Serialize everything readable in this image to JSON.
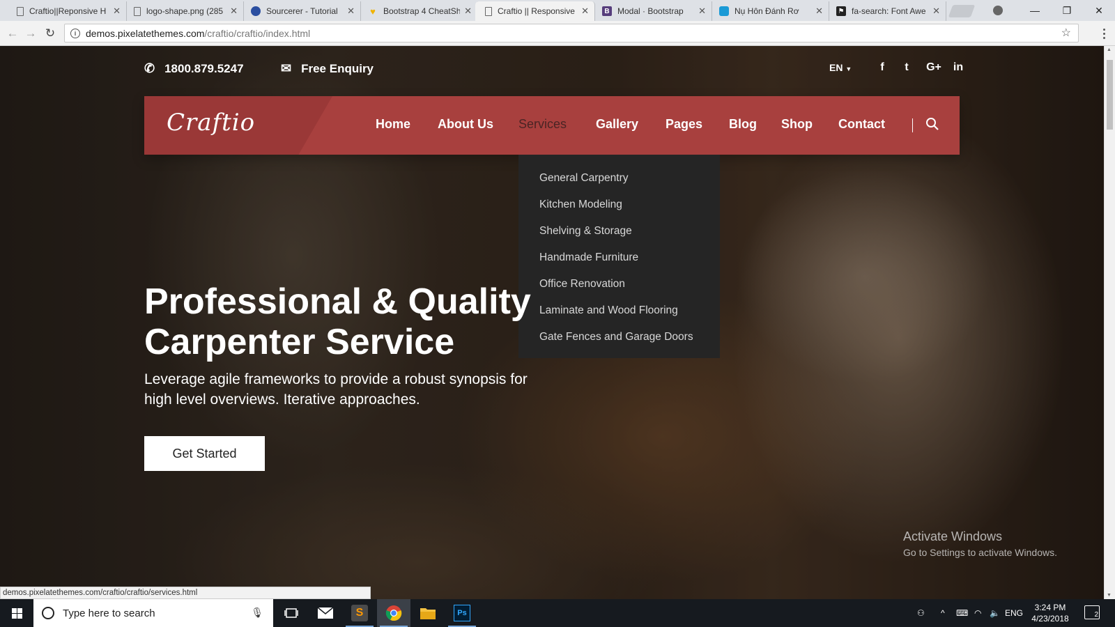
{
  "browser": {
    "tabs": [
      {
        "title": "Craftio||Reponsive H",
        "favicon": "page-icon"
      },
      {
        "title": "logo-shape.png (285",
        "favicon": "page-icon"
      },
      {
        "title": "Sourcerer - Tutorial",
        "favicon": "shield-icon"
      },
      {
        "title": "Bootstrap 4 CheatSh",
        "favicon": "heart-icon"
      },
      {
        "title": "Craftio || Responsive",
        "favicon": "page-icon",
        "active": true
      },
      {
        "title": "Modal · Bootstrap",
        "favicon": "bootstrap-icon"
      },
      {
        "title": "Nụ Hôn Đánh Rơ",
        "favicon": "zing-icon"
      },
      {
        "title": "fa-search: Font Awe",
        "favicon": "flag-icon"
      }
    ],
    "url_host": "demos.pixelatethemes.com",
    "url_path": "/craftio/craftio/index.html",
    "status_url": "demos.pixelatethemes.com/craftio/craftio/services.html"
  },
  "topbar": {
    "phone": "1800.879.5247",
    "enquiry": "Free Enquiry",
    "language": "EN",
    "social": [
      "f",
      "t",
      "G+",
      "in"
    ]
  },
  "nav": {
    "logo": "Craftio",
    "links": [
      "Home",
      "About Us",
      "Services",
      "Gallery",
      "Pages",
      "Blog",
      "Shop",
      "Contact"
    ],
    "current": "Services"
  },
  "dropdown": {
    "items": [
      "General Carpentry",
      "Kitchen Modeling",
      "Shelving & Storage",
      "Handmade Furniture",
      "Office Renovation",
      "Laminate and Wood Flooring",
      "Gate Fences and Garage Doors"
    ]
  },
  "hero": {
    "title_line1": "Professional & Quality",
    "title_line2": "Carpenter Service",
    "subtitle": "Leverage agile frameworks to provide a robust synopsis for high level overviews. Iterative approaches.",
    "button": "Get Started"
  },
  "watermark": {
    "line1": "Activate Windows",
    "line2": "Go to Settings to activate Windows."
  },
  "taskbar": {
    "search_placeholder": "Type here to search",
    "language": "ENG",
    "time": "3:24 PM",
    "date": "4/23/2018",
    "notifications": "2"
  },
  "colors": {
    "accent": "#a8403e",
    "dropdown_bg": "#252525",
    "taskbar": "#161a1f"
  }
}
